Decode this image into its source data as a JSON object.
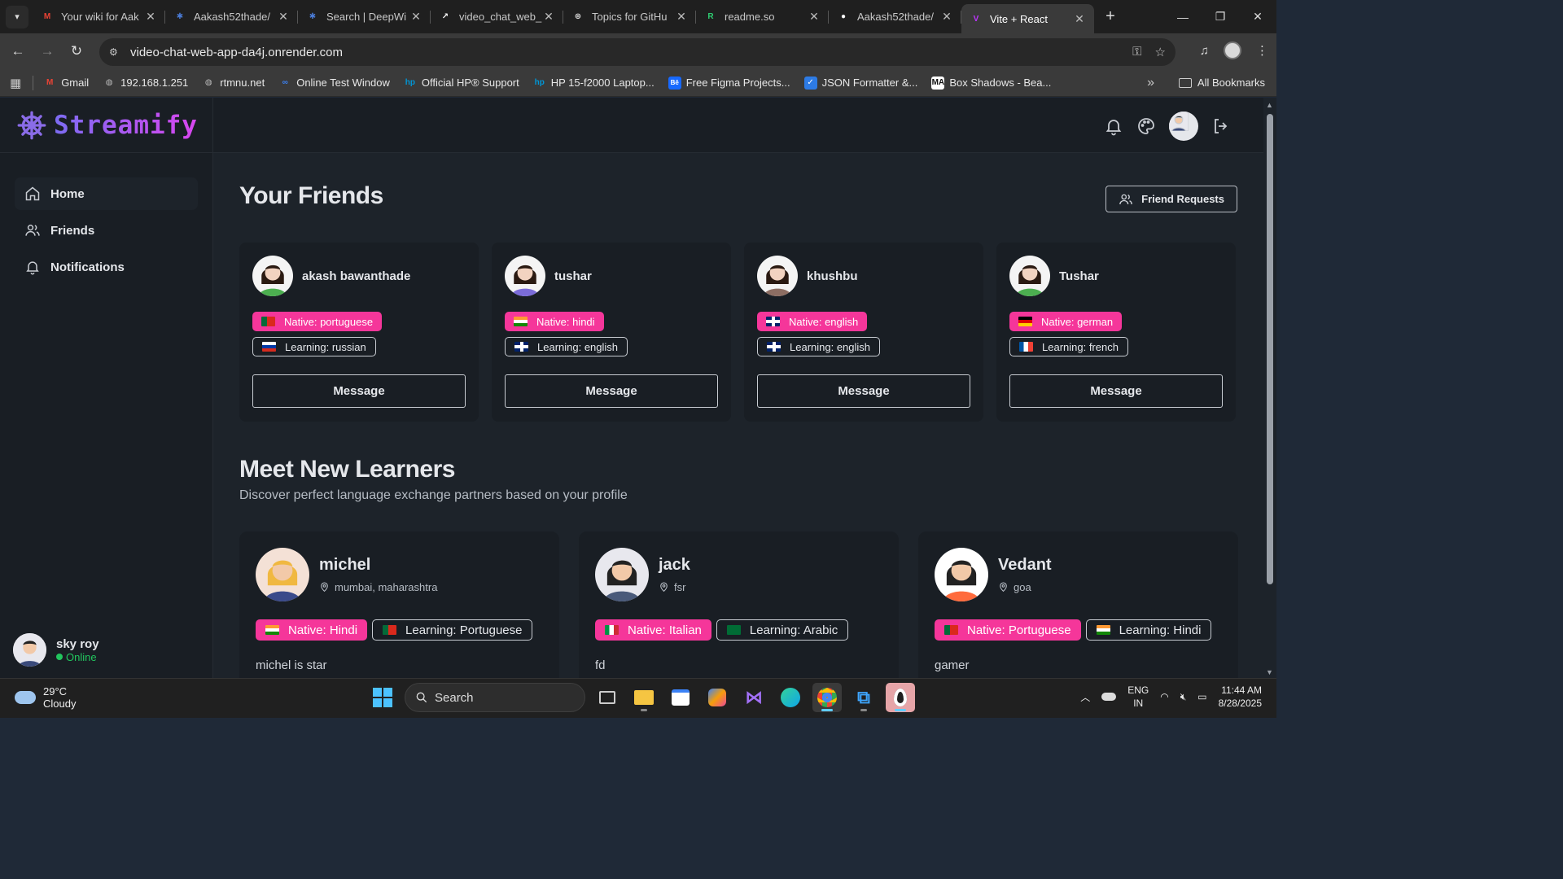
{
  "browser": {
    "tabs": [
      {
        "title": "Your wiki for Aak",
        "icon": "gmail-icon",
        "color": "#ea4335",
        "glyph": "M"
      },
      {
        "title": "Aakash52thade/",
        "icon": "deepwiki-icon",
        "color": "#4a7bd6",
        "glyph": "✱"
      },
      {
        "title": "Search | DeepWi",
        "icon": "deepwiki-icon",
        "color": "#4a7bd6",
        "glyph": "✱"
      },
      {
        "title": "video_chat_web_",
        "icon": "render-icon",
        "color": "#ffffff",
        "glyph": "↗"
      },
      {
        "title": "Topics for GitHu",
        "icon": "openai-icon",
        "color": "#dddddd",
        "glyph": "⊛"
      },
      {
        "title": "readme.so",
        "icon": "readme-icon",
        "color": "#2ecc71",
        "glyph": "R"
      },
      {
        "title": "Aakash52thade/",
        "icon": "github-icon",
        "color": "#ffffff",
        "glyph": "●"
      },
      {
        "title": "Vite + React",
        "icon": "vite-icon",
        "color": "#bd34fe",
        "glyph": "V"
      }
    ],
    "url": "video-chat-web-app-da4j.onrender.com",
    "bookmarks": [
      {
        "label": "Gmail",
        "icon": "gmail-icon",
        "color": "#ea4335",
        "glyph": "M"
      },
      {
        "label": "192.168.1.251",
        "icon": "globe-icon",
        "color": "#bbbbbb",
        "glyph": "◍"
      },
      {
        "label": "rtmnu.net",
        "icon": "globe-icon",
        "color": "#bbbbbb",
        "glyph": "◍"
      },
      {
        "label": "Online Test Window",
        "icon": "infinity-icon",
        "color": "#3b82f6",
        "glyph": "∞"
      },
      {
        "label": "Official HP® Support",
        "icon": "hp-icon",
        "color": "#0096d6",
        "glyph": "hp"
      },
      {
        "label": "HP 15-f2000 Laptop...",
        "icon": "hp-icon",
        "color": "#0096d6",
        "glyph": "hp"
      },
      {
        "label": "Free Figma Projects...",
        "icon": "behance-icon",
        "color": "#1769ff",
        "glyph": "Bē"
      },
      {
        "label": "JSON Formatter &...",
        "icon": "check-icon",
        "color": "#2d7be5",
        "glyph": "✓"
      },
      {
        "label": "Box Shadows - Bea...",
        "icon": "ma-icon",
        "color": "#111111",
        "glyph": "MA"
      }
    ],
    "all_bookmarks": "All Bookmarks"
  },
  "app": {
    "brand": "Streamify",
    "nav": [
      {
        "label": "Home",
        "icon": "home-icon"
      },
      {
        "label": "Friends",
        "icon": "users-icon"
      },
      {
        "label": "Notifications",
        "icon": "bell-icon"
      }
    ],
    "current_user": {
      "name": "sky roy",
      "status": "Online"
    },
    "friends_title": "Your Friends",
    "friend_requests_label": "Friend Requests",
    "message_label": "Message",
    "friends": [
      {
        "name": "akash bawanthade",
        "native": "Native: portuguese",
        "learning": "Learning: russian",
        "native_flag": "portugal",
        "learning_flag": "russia",
        "skin": "#f2d3c0",
        "hair": "#2a1a12",
        "shirt": "#4caf50"
      },
      {
        "name": "tushar",
        "native": "Native: hindi",
        "learning": "Learning: english",
        "native_flag": "india",
        "learning_flag": "uk",
        "skin": "#f2d3c0",
        "hair": "#2a1a12",
        "shirt": "#7b6cd9"
      },
      {
        "name": "khushbu",
        "native": "Native: english",
        "learning": "Learning: english",
        "native_flag": "uk",
        "learning_flag": "uk",
        "skin": "#f2d3c0",
        "hair": "#2a1a12",
        "shirt": "#8d6e63"
      },
      {
        "name": "Tushar",
        "native": "Native: german",
        "learning": "Learning: french",
        "native_flag": "germany",
        "learning_flag": "france",
        "skin": "#f2d3c0",
        "hair": "#2a1a12",
        "shirt": "#4caf50"
      }
    ],
    "learners_title": "Meet New Learners",
    "learners_subtitle": "Discover perfect language exchange partners based on your profile",
    "learners": [
      {
        "name": "michel",
        "location": "mumbai, maharashtra",
        "native": "Native: Hindi",
        "learning": "Learning: Portuguese",
        "native_flag": "india",
        "learning_flag": "portugal",
        "bio": "michel is star",
        "bg": "#f4e1d6",
        "hair": "#f0b840",
        "shirt": "#3a4a8a"
      },
      {
        "name": "jack",
        "location": "fsr",
        "native": "Native: Italian",
        "learning": "Learning: Arabic",
        "native_flag": "italy",
        "learning_flag": "saudi",
        "bio": "fd",
        "bg": "#e8e8ee",
        "hair": "#222222",
        "shirt": "#4a5a7a"
      },
      {
        "name": "Vedant",
        "location": "goa",
        "native": "Native: Portuguese",
        "learning": "Learning: Hindi",
        "native_flag": "portugal",
        "learning_flag": "india",
        "bio": "gamer",
        "bg": "#ffffff",
        "hair": "#222222",
        "shirt": "#ff6b3d"
      }
    ]
  },
  "taskbar": {
    "temp": "29°C",
    "condition": "Cloudy",
    "search": "Search",
    "lang_top": "ENG",
    "lang_bottom": "IN",
    "time": "11:44 AM",
    "date": "8/28/2025"
  },
  "colors": {
    "accent_pink": "#f5369a",
    "brand_purple": "#8a6ce8",
    "online_green": "#22c55e"
  }
}
